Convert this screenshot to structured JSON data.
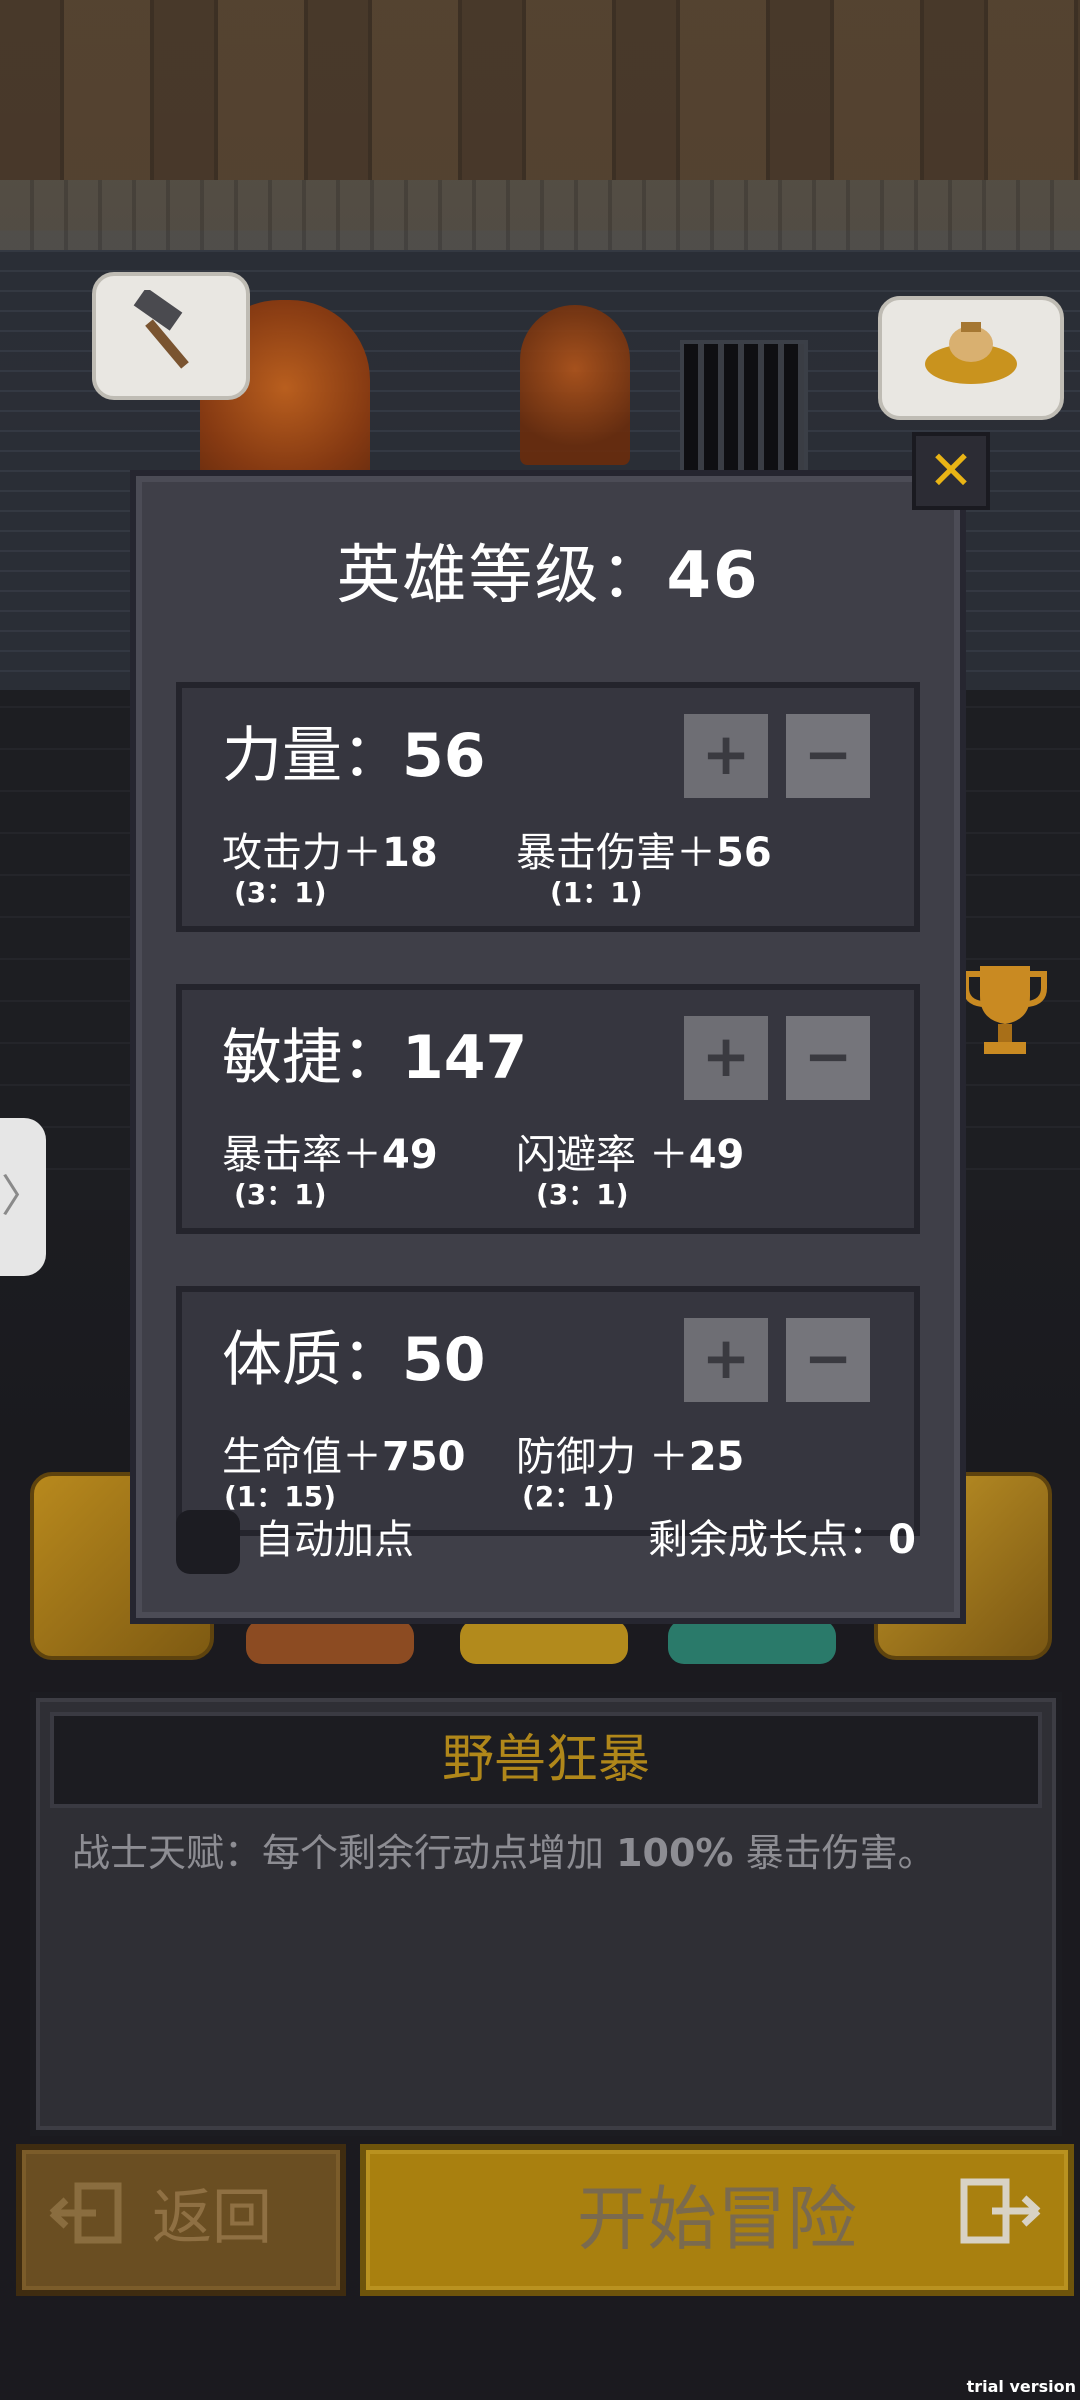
{
  "scene": {
    "hammer_icon": "hammer-icon",
    "bag_icon": "gold-bag-icon",
    "trophy_icon": "trophy-icon",
    "side_tab_glyph": "〉"
  },
  "popup": {
    "level_label": "英雄等级：",
    "level_value": "46",
    "close_glyph": "✕",
    "stats": [
      {
        "name_label": "力量：",
        "value": "56",
        "sub1_label": "攻击力＋",
        "sub1_value": "18",
        "sub1_ratio": "(3：1)",
        "sub2_label": "暴击伤害＋",
        "sub2_value": "56",
        "sub2_ratio": "(1：1)"
      },
      {
        "name_label": "敏捷：",
        "value": "147",
        "sub1_label": "暴击率＋",
        "sub1_value": "49",
        "sub1_ratio": "(3：1)",
        "sub2_label": "闪避率 ＋",
        "sub2_value": "49",
        "sub2_ratio": "(3：1)"
      },
      {
        "name_label": "体质：",
        "value": "50",
        "sub1_label": "生命值＋",
        "sub1_value": "750",
        "sub1_ratio": "(1：15)",
        "sub2_label": "防御力 ＋",
        "sub2_value": "25",
        "sub2_ratio": "(2：1)"
      }
    ],
    "plus_label": "+",
    "minus_label": "−",
    "auto_label": "自动加点",
    "remaining_label": "剩余成长点：",
    "remaining_value": "0"
  },
  "talent": {
    "title": "野兽狂暴",
    "desc_prefix": "战士天赋：每个剩余行动点增加 ",
    "desc_highlight": "100%",
    "desc_suffix": " 暴击伤害。"
  },
  "footer": {
    "back_label": "返回",
    "back_icon": "exit-left-icon",
    "start_label": "开始冒险",
    "start_icon": "exit-right-icon"
  },
  "watermark": "trial version",
  "colors": {
    "accent_gold": "#a9800f",
    "talent_title": "#b0871a",
    "panel": "#3f3f48",
    "close_icon": "#e9b415"
  }
}
